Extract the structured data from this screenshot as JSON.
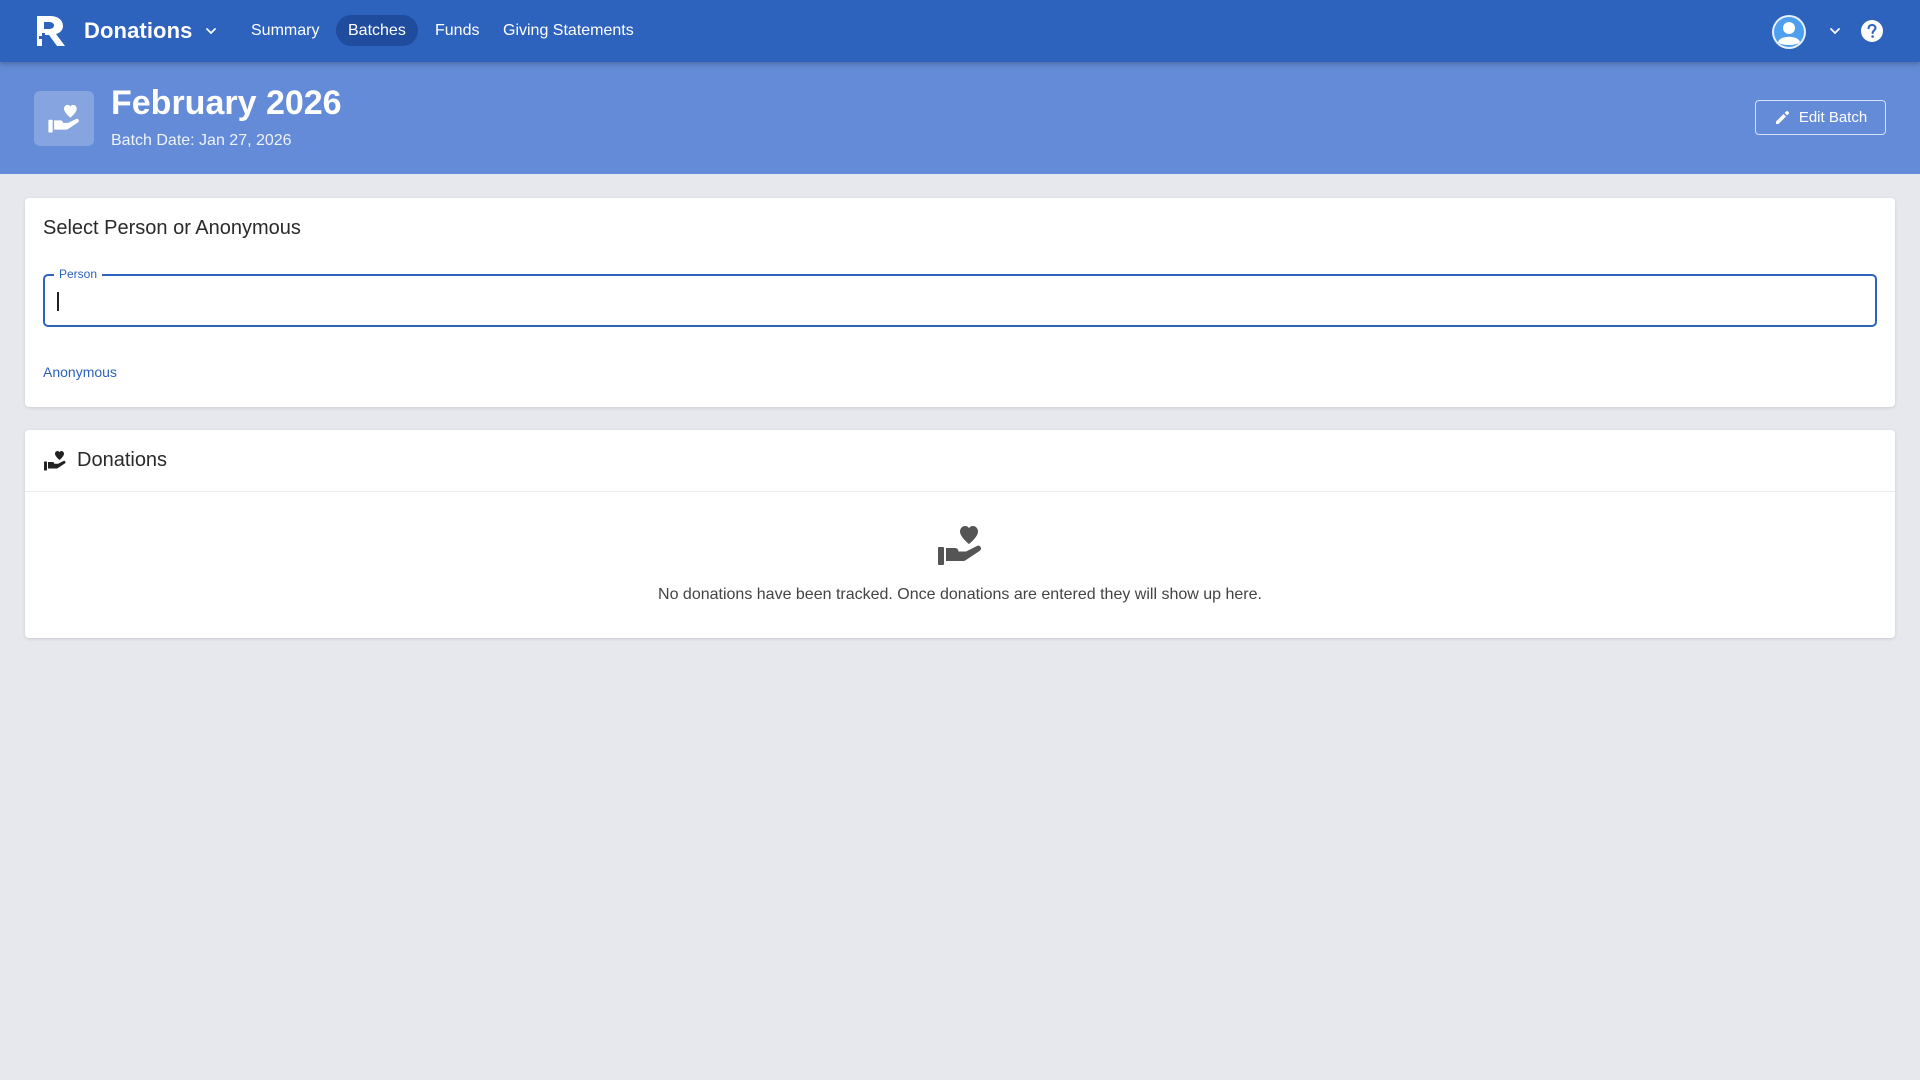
{
  "header": {
    "app_title": "Donations",
    "tabs": [
      {
        "label": "Summary",
        "active": false
      },
      {
        "label": "Batches",
        "active": true
      },
      {
        "label": "Funds",
        "active": false
      },
      {
        "label": "Giving Statements",
        "active": false
      }
    ]
  },
  "banner": {
    "title": "February 2026",
    "subtitle": "Batch Date: Jan 27, 2026",
    "edit_label": "Edit Batch"
  },
  "select_card": {
    "title": "Select Person or Anonymous",
    "field_label": "Person",
    "field_value": "",
    "anonymous_label": "Anonymous"
  },
  "donations_card": {
    "title": "Donations",
    "empty_message": "No donations have been tracked. Once donations are entered they will show up here."
  },
  "icons": {
    "logo": "church-logo-icon",
    "app_chevron": "chevron-down-icon",
    "avatar": "user-avatar-icon",
    "user_chevron": "chevron-down-icon",
    "help": "help-icon",
    "banner": "hand-heart-icon",
    "edit": "pencil-icon",
    "donations": "hand-heart-icon"
  },
  "colors": {
    "topbar": "#2d62bd",
    "banner": "#648bd7",
    "active_tab": "#1f4c9c",
    "background": "#e6e8ed",
    "accent": "#2d62bd"
  }
}
